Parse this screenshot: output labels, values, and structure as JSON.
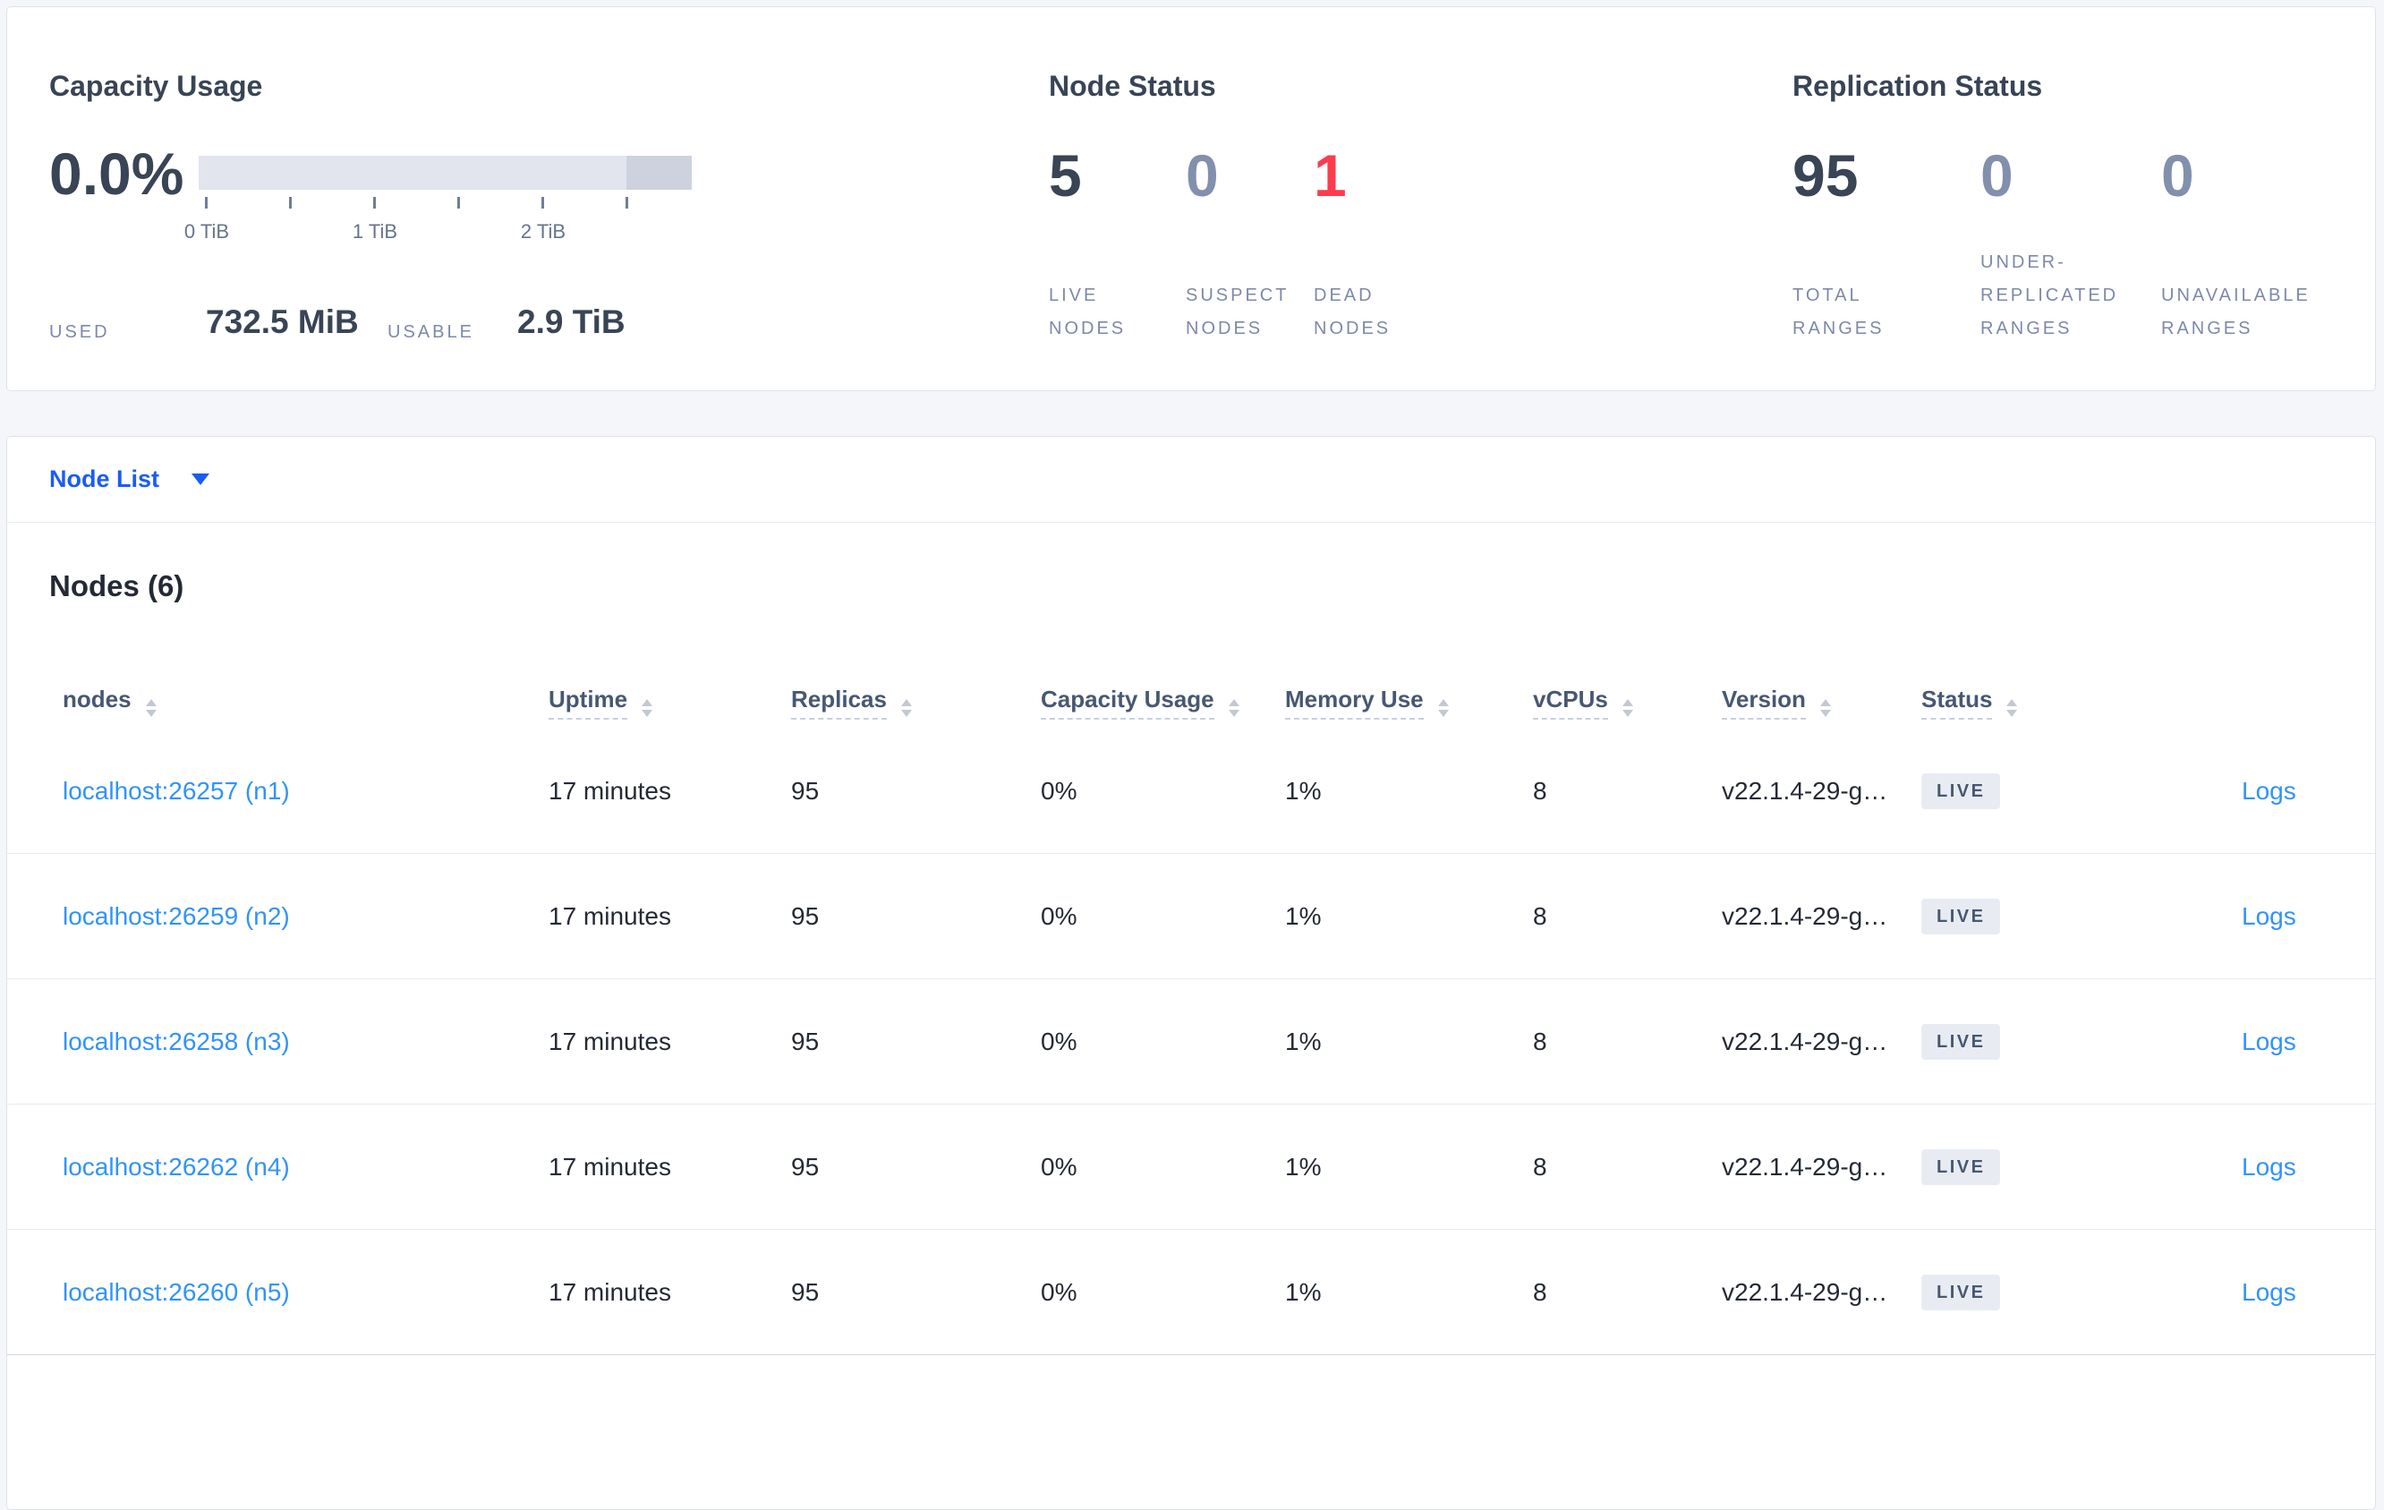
{
  "capacity": {
    "title": "Capacity Usage",
    "percent": "0.0%",
    "tick_labels": [
      "0 TiB",
      "1 TiB",
      "2 TiB"
    ],
    "used_label": "USED",
    "used_value": "732.5 MiB",
    "usable_label": "USABLE",
    "usable_value": "2.9 TiB"
  },
  "node_status": {
    "title": "Node Status",
    "stats": [
      {
        "value": "5",
        "label": "LIVE NODES",
        "variant": "primary"
      },
      {
        "value": "0",
        "label": "SUSPECT NODES",
        "variant": "muted"
      },
      {
        "value": "1",
        "label": "DEAD NODES",
        "variant": "danger"
      }
    ]
  },
  "replication_status": {
    "title": "Replication Status",
    "stats": [
      {
        "value": "95",
        "label": "TOTAL RANGES",
        "variant": "primary"
      },
      {
        "value": "0",
        "label": "UNDER-REPLICATED RANGES",
        "variant": "muted"
      },
      {
        "value": "0",
        "label": "UNAVAILABLE RANGES",
        "variant": "muted"
      }
    ]
  },
  "view_selector": {
    "label": "Node List"
  },
  "nodes_section": {
    "heading": "Nodes (6)",
    "columns": [
      {
        "label": "nodes"
      },
      {
        "label": "Uptime"
      },
      {
        "label": "Replicas"
      },
      {
        "label": "Capacity Usage"
      },
      {
        "label": "Memory Use"
      },
      {
        "label": "vCPUs"
      },
      {
        "label": "Version"
      },
      {
        "label": "Status"
      }
    ],
    "rows": [
      {
        "node": "localhost:26257 (n1)",
        "uptime": "17 minutes",
        "replicas": "95",
        "capacity": "0%",
        "memory": "1%",
        "vcpus": "8",
        "version": "v22.1.4-29-g…",
        "status": "LIVE",
        "logs": "Logs"
      },
      {
        "node": "localhost:26259 (n2)",
        "uptime": "17 minutes",
        "replicas": "95",
        "capacity": "0%",
        "memory": "1%",
        "vcpus": "8",
        "version": "v22.1.4-29-g…",
        "status": "LIVE",
        "logs": "Logs"
      },
      {
        "node": "localhost:26258 (n3)",
        "uptime": "17 minutes",
        "replicas": "95",
        "capacity": "0%",
        "memory": "1%",
        "vcpus": "8",
        "version": "v22.1.4-29-g…",
        "status": "LIVE",
        "logs": "Logs"
      },
      {
        "node": "localhost:26262 (n4)",
        "uptime": "17 minutes",
        "replicas": "95",
        "capacity": "0%",
        "memory": "1%",
        "vcpus": "8",
        "version": "v22.1.4-29-g…",
        "status": "LIVE",
        "logs": "Logs"
      },
      {
        "node": "localhost:26260 (n5)",
        "uptime": "17 minutes",
        "replicas": "95",
        "capacity": "0%",
        "memory": "1%",
        "vcpus": "8",
        "version": "v22.1.4-29-g…",
        "status": "LIVE",
        "logs": "Logs"
      }
    ]
  },
  "colors": {
    "page_background": "#f4f6fa",
    "panel_border": "#e0e3eb",
    "primary_text": "#394455",
    "muted_stat": "#8290ae",
    "danger": "#ff3b4e",
    "stat_label": "#7e89a9",
    "dropdown_blue": "#1b5cf5",
    "link_blue": "#3193fa",
    "bar_fill": "#e2e5ee",
    "bar_extra": "#ced2de",
    "badge_bg": "#e8ecf2",
    "badge_text": "#475872"
  }
}
